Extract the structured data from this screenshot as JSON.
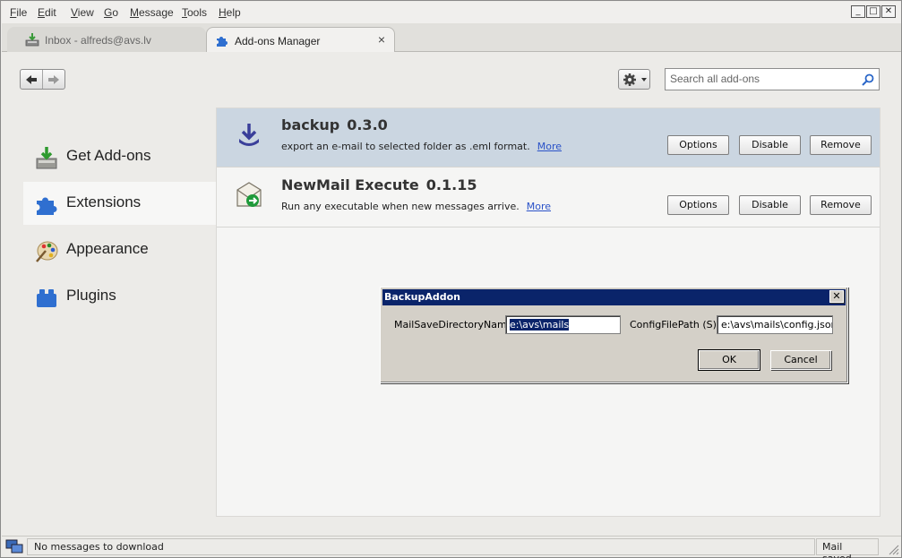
{
  "menubar": {
    "items": [
      {
        "label": "File",
        "mnemonic": "F",
        "rest": "ile"
      },
      {
        "label": "Edit",
        "mnemonic": "E",
        "rest": "dit"
      },
      {
        "label": "View",
        "mnemonic": "V",
        "rest": "iew"
      },
      {
        "label": "Go",
        "mnemonic": "G",
        "rest": "o"
      },
      {
        "label": "Message",
        "mnemonic": "M",
        "rest": "essage"
      },
      {
        "label": "Tools",
        "mnemonic": "T",
        "rest": "ools"
      },
      {
        "label": "Help",
        "mnemonic": "H",
        "rest": "elp"
      }
    ]
  },
  "tabs": [
    {
      "label": "Inbox - alfreds@avs.lv",
      "icon": "inbox-download-icon"
    },
    {
      "label": "Add-ons Manager",
      "icon": "puzzle-icon",
      "close": "×"
    }
  ],
  "toolbar": {
    "back_icon": "back-arrow-icon",
    "forward_icon": "forward-arrow-icon",
    "tools_icon": "gear-icon",
    "search_placeholder": "Search all add-ons"
  },
  "sidebar": {
    "items": [
      {
        "label": "Get Add-ons",
        "icon": "get-addons-icon"
      },
      {
        "label": "Extensions",
        "icon": "puzzle-icon",
        "selected": true
      },
      {
        "label": "Appearance",
        "icon": "palette-icon"
      },
      {
        "label": "Plugins",
        "icon": "plugin-block-icon"
      }
    ]
  },
  "addons": [
    {
      "name": "backup",
      "version": "0.3.0",
      "description": "export an e-mail to selected folder as .eml format.",
      "more": "More",
      "selected": true,
      "buttons": {
        "options": "Options",
        "disable": "Disable",
        "remove": "Remove"
      }
    },
    {
      "name": "NewMail Execute",
      "version": "0.1.15",
      "description": "Run any executable when new messages arrive.",
      "more": "More",
      "selected": false,
      "buttons": {
        "options": "Options",
        "disable": "Disable",
        "remove": "Remove"
      }
    }
  ],
  "dialog": {
    "title": "BackupAddon",
    "close": "✕",
    "mail_dir_label": "MailSaveDirectoryName",
    "mail_dir_value": "e:\\avs\\mails",
    "config_label": "ConfigFilePath (S)",
    "config_value": "e:\\avs\\mails\\config.json",
    "ok": "OK",
    "cancel": "Cancel"
  },
  "statusbar": {
    "text": "No messages to download",
    "right": "Mail saved."
  },
  "colors": {
    "selected_row": "#cbd6e1",
    "dialog_title": "#0a246a",
    "link": "#2a52c8"
  }
}
